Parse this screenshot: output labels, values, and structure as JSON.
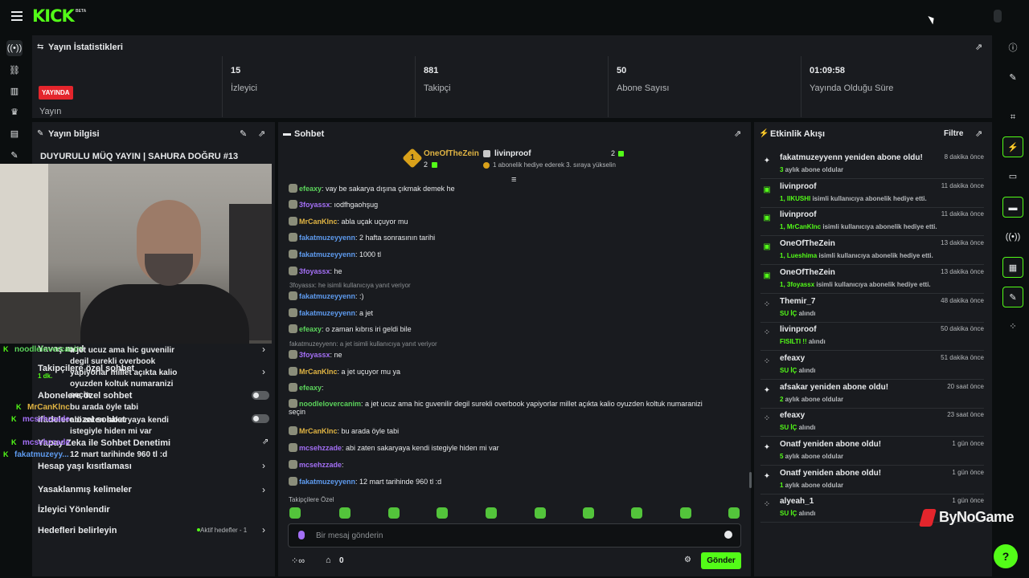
{
  "header": {
    "logo": "KICK",
    "beta": "BETA"
  },
  "stats": {
    "title": "Yayın İstatistikleri",
    "live_badge": "YAYINDA",
    "items": [
      {
        "value": "",
        "label": "Yayın"
      },
      {
        "value": "15",
        "label": "İzleyici"
      },
      {
        "value": "881",
        "label": "Takipçi"
      },
      {
        "value": "50",
        "label": "Abone Sayısı"
      },
      {
        "value": "01:09:58",
        "label": "Yayında Olduğu Süre"
      }
    ]
  },
  "info": {
    "title": "Yayın bilgisi",
    "stream_title": "DUYURULU MÜQ YAYIN | SAHURA DOĞRU #13",
    "menu": {
      "slow_mode": "Yavaş mod",
      "followers": "Takipçilere özel sohbet",
      "subscribers": "Abonelere özel sohbet",
      "emote": "ifadelere özel sohbet",
      "moderation": "Yapay Zeka ile Sohbet Denetimi",
      "age": "Hesap yaşı kısıtlaması",
      "banned": "Yasaklanmış kelimeler",
      "redirect": "İzleyici Yönlendir",
      "goals": "Hedefleri belirleyin",
      "goals_status": "Aktif hedefler - 1"
    },
    "overlay": [
      {
        "name": "noodlelovercanim",
        "text": "a jet ucuz ama hic guvenilir degil surekli overbook yapiyorlar millet açıkta kalio oyuzden koltuk numaranizi seçin",
        "sub": "1 dk."
      },
      {
        "name": "MrCanKlnc",
        "text": "bu arada öyle tabi"
      },
      {
        "name": "mcsehzzade",
        "text": "abi zaten sakaryaya kendi istegiyle hiden mi var"
      },
      {
        "name": "mcsehzzade",
        "text": ""
      },
      {
        "name": "fakatmuzeyy...",
        "text": "12 mart tarihinde 960 tl :d"
      }
    ]
  },
  "chat": {
    "title": "Sohbet",
    "pinned": {
      "rank": "1",
      "gifter": "OneOfTheZein",
      "gifter_count": "2",
      "user": "livinproof",
      "user_count": "2",
      "message": "1 abonelik hediye ederek 3. sıraya yükselin"
    },
    "messages": [
      {
        "user": "efeaxy",
        "text": ": vay be sakarya dışına çıkmak demek he",
        "color": "#5bd35b"
      },
      {
        "user": "3foyassx",
        "text": ": ıodfhgaohşug",
        "color": "#a36ff5"
      },
      {
        "user": "MrCanKlnc",
        "text": ": abla uçak uçuyor mu",
        "color": "#e0b443"
      },
      {
        "user": "fakatmuzeyyenn",
        "text": ": 2 hafta sonrasının tarihi",
        "color": "#5e9bef"
      },
      {
        "user": "fakatmuzeyyenn",
        "text": ": 1000 tl",
        "color": "#5e9bef"
      },
      {
        "user": "3foyassx",
        "text": ": he",
        "color": "#a36ff5"
      },
      {
        "reply": "3foyassx: he isimli kullanıcıya yanıt veriyor"
      },
      {
        "user": "fakatmuzeyyenn",
        "text": ": :)",
        "color": "#5e9bef"
      },
      {
        "user": "fakatmuzeyyenn",
        "text": ": a jet",
        "color": "#5e9bef"
      },
      {
        "user": "efeaxy",
        "text": ": o zaman kıbrıs iri geldi bile",
        "color": "#5bd35b"
      },
      {
        "reply": "fakatmuzeyyenn: a jet isimli kullanıcıya yanıt veriyor"
      },
      {
        "user": "3foyassx",
        "text": ": ne",
        "color": "#a36ff5"
      },
      {
        "user": "MrCanKlnc",
        "text": ": a jet uçuyor mu ya",
        "color": "#e0b443"
      },
      {
        "user": "efeaxy",
        "text": ":",
        "color": "#5bd35b"
      },
      {
        "user": "noodlelovercanim",
        "text": ": a jet ucuz ama hic guvenilir degil surekli overbook yapiyorlar millet açıkta kalio oyuzden koltuk numaranizi",
        "text2": "seçin",
        "color": "#5bd35b"
      },
      {
        "user": "MrCanKlnc",
        "text": ": bu arada öyle tabi",
        "color": "#e0b443"
      },
      {
        "user": "mcsehzzade",
        "text": ": abi zaten sakaryaya kendi istegiyle hiden mi var",
        "color": "#a36ff5"
      },
      {
        "user": "mcsehzzade",
        "text": ":",
        "color": "#a36ff5"
      },
      {
        "user": "fakatmuzeyyenn",
        "text": ": 12 mart tarihinde 960 tl :d",
        "color": "#5e9bef"
      }
    ],
    "emote_label": "Takipçilere Özel",
    "input_placeholder": "Bir mesaj gönderin",
    "points": "0",
    "send_label": "Gönder"
  },
  "feed": {
    "title": "Etkinlik Akışı",
    "filter": "Filtre",
    "items": [
      {
        "title": "fakatmuzeyyenn yeniden abone oldu!",
        "name": "3",
        "sub": " aylık abone oldular",
        "time": "8 dakika önce",
        "icon": "star"
      },
      {
        "title": "livinproof",
        "name": "1, IIKUSHI",
        "sub": " isimli kullanıcıya abonelik hediye etti.",
        "time": "11 dakika önce",
        "icon": "gift"
      },
      {
        "title": "livinproof",
        "name": "1, MrCanKlnc",
        "sub": " isimli kullanıcıya abonelik hediye etti.",
        "time": "11 dakika önce",
        "icon": "gift"
      },
      {
        "title": "OneOfTheZein",
        "name": "1, Lueshima",
        "sub": " isimli kullanıcıya abonelik hediye etti.",
        "time": "13 dakika önce",
        "icon": "gift"
      },
      {
        "title": "OneOfTheZein",
        "name": "1, 3foyassx",
        "sub": " isimli kullanıcıya abonelik hediye etti.",
        "time": "13 dakika önce",
        "icon": "gift"
      },
      {
        "title": "Themir_7",
        "name": "SU İÇ",
        "sub": " alındı",
        "time": "48 dakika önce",
        "icon": "dots"
      },
      {
        "title": "livinproof",
        "name": "FISILTI !!",
        "sub": " alındı",
        "time": "50 dakika önce",
        "icon": "dots"
      },
      {
        "title": "efeaxy",
        "name": "SU İÇ",
        "sub": " alındı",
        "time": "51 dakika önce",
        "icon": "dots"
      },
      {
        "title": "afsakar yeniden abone oldu!",
        "name": "2",
        "sub": " aylık abone oldular",
        "time": "20 saat önce",
        "icon": "star"
      },
      {
        "title": "efeaxy",
        "name": "SU İÇ",
        "sub": " alındı",
        "time": "23 saat önce",
        "icon": "dots"
      },
      {
        "title": "Onatf yeniden abone oldu!",
        "name": "5",
        "sub": " aylık abone oldular",
        "time": "1 gün önce",
        "icon": "star"
      },
      {
        "title": "Onatf yeniden abone oldu!",
        "name": "1",
        "sub": " aylık abone oldular",
        "time": "1 gün önce",
        "icon": "star"
      },
      {
        "title": "alyeah_1",
        "name": "SU İÇ",
        "sub": " alındı",
        "time": "1 gün önce",
        "icon": "dots"
      }
    ]
  },
  "watermark": "ByNoGame",
  "colors": {
    "accent": "#53fc18",
    "live": "#e4252c",
    "panel": "#191b1f"
  }
}
